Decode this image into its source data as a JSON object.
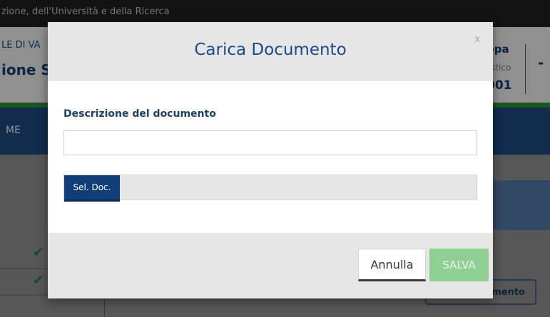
{
  "background": {
    "topbar_text": "zione, dell'Università e della Ricerca",
    "school_text": "LE DI VA",
    "section_title": "ione S",
    "user": {
      "name": "ppa",
      "role": "stico",
      "code": "001",
      "action": "-"
    },
    "nav_item": "ME",
    "rows": [
      {
        "check": "✔"
      },
      {
        "check": "✔"
      }
    ],
    "doc_button_label": "umento"
  },
  "modal": {
    "title": "Carica Documento",
    "close_label": "x",
    "description_label": "Descrizione del documento",
    "description_value": "",
    "file_button_label": "Sel. Doc.",
    "file_name": "",
    "cancel_label": "Annulla",
    "save_label": "SALVA"
  },
  "colors": {
    "title": "#1b4a8a",
    "primary": "#0f3e78",
    "save_disabled": "#8fcf93",
    "accent_green": "#2d8a3a"
  }
}
